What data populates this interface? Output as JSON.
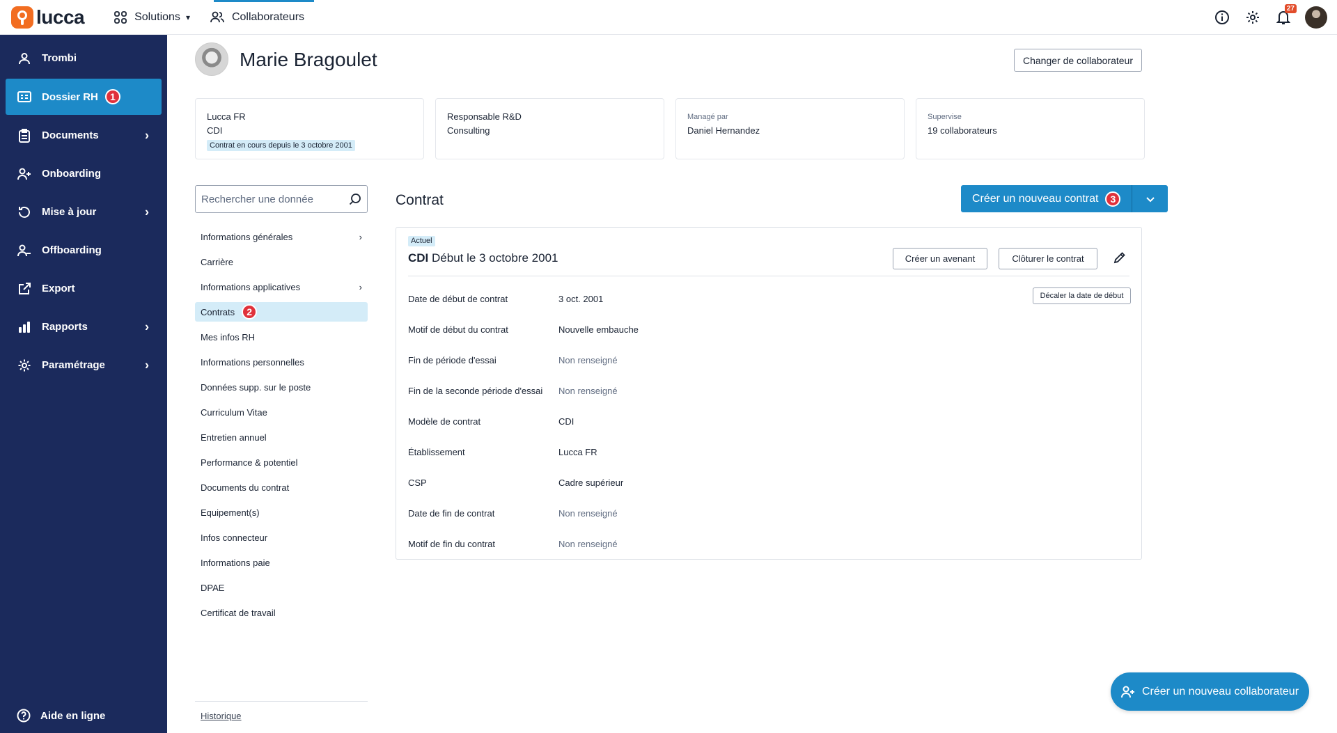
{
  "app": {
    "logo_text": "lucca",
    "brand_color": "#f26d21",
    "accent_color": "#1d8ac8",
    "sidebar_color": "#1b2a5c"
  },
  "topbar": {
    "nav": [
      {
        "label": "Solutions",
        "icon": "grid-icon",
        "chevron": "▾"
      },
      {
        "label": "Collaborateurs",
        "icon": "users-icon"
      }
    ],
    "notifications_count": "27"
  },
  "sidebar": {
    "items": [
      {
        "label": "Trombi",
        "icon": "person-icon"
      },
      {
        "label": "Dossier RH",
        "icon": "id-card-icon",
        "badge": "1"
      },
      {
        "label": "Documents",
        "icon": "clipboard-icon",
        "chevron": "›"
      },
      {
        "label": "Onboarding",
        "icon": "user-plus-icon"
      },
      {
        "label": "Mise à jour",
        "icon": "refresh-icon",
        "chevron": "›"
      },
      {
        "label": "Offboarding",
        "icon": "user-minus-icon"
      },
      {
        "label": "Export",
        "icon": "external-link-icon"
      },
      {
        "label": "Rapports",
        "icon": "bar-chart-icon",
        "chevron": "›"
      },
      {
        "label": "Paramétrage",
        "icon": "gear-icon",
        "chevron": "›"
      }
    ],
    "help_label": "Aide en ligne"
  },
  "profile": {
    "name": "Marie Bragoulet",
    "change_button": "Changer de collaborateur"
  },
  "cards": {
    "entity": "Lucca FR",
    "contract_type": "CDI",
    "contract_status": "Contrat en cours depuis le 3 octobre 2001",
    "job_title": "Responsable R&D",
    "department": "Consulting",
    "manager_label": "Managé par",
    "manager_name": "Daniel Hernandez",
    "supervise_label": "Supervise",
    "supervise_value": "19 collaborateurs"
  },
  "field_menu": {
    "search_placeholder": "Rechercher une donnée",
    "items": [
      {
        "label": "Informations générales",
        "chevron": "›"
      },
      {
        "label": "Carrière"
      },
      {
        "label": "Informations applicatives",
        "chevron": "›"
      },
      {
        "label": "Contrats",
        "badge": "2"
      },
      {
        "label": "Mes infos RH"
      },
      {
        "label": "Informations personnelles"
      },
      {
        "label": "Données supp. sur le poste"
      },
      {
        "label": "Curriculum Vitae"
      },
      {
        "label": "Entretien annuel"
      },
      {
        "label": "Performance & potentiel"
      },
      {
        "label": "Documents du contrat"
      },
      {
        "label": "Equipement(s)"
      },
      {
        "label": "Infos connecteur"
      },
      {
        "label": "Informations paie"
      },
      {
        "label": "DPAE"
      },
      {
        "label": "Certificat de travail"
      }
    ],
    "history_link": "Historique"
  },
  "contract": {
    "section_title": "Contrat",
    "create_button": "Créer un nouveau contrat",
    "create_badge": "3",
    "current_pill": "Actuel",
    "head_type": "CDI",
    "head_start": "Début le 3 octobre 2001",
    "avenant_button": "Créer un avenant",
    "close_button": "Clôturer le contrat",
    "shift_button": "Décaler la date de début",
    "rows": [
      {
        "label": "Date de début de contrat",
        "value": "3 oct. 2001"
      },
      {
        "label": "Motif de début du contrat",
        "value": "Nouvelle embauche"
      },
      {
        "label": "Fin de période d'essai",
        "value": "Non renseigné"
      },
      {
        "label": "Fin de la seconde période d'essai",
        "value": "Non renseigné"
      },
      {
        "label": "Modèle de contrat",
        "value": "CDI"
      },
      {
        "label": "Établissement",
        "value": "Lucca FR"
      },
      {
        "label": "CSP",
        "value": "Cadre supérieur"
      },
      {
        "label": "Date de fin de contrat",
        "value": "Non renseigné"
      },
      {
        "label": "Motif de fin du contrat",
        "value": "Non renseigné"
      }
    ]
  },
  "fab": {
    "label": "Créer un nouveau collaborateur"
  }
}
